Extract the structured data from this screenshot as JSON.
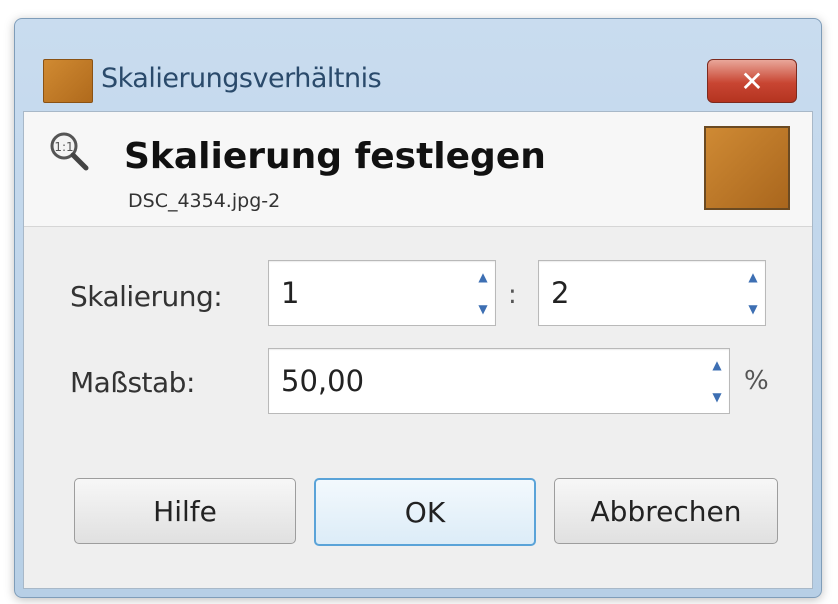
{
  "window": {
    "title": "Skalierungsverhältnis",
    "close_label": "✕"
  },
  "header": {
    "title": "Skalierung festlegen",
    "subtitle": "DSC_4354.jpg-2"
  },
  "form": {
    "scale_label": "Skalierung:",
    "scale_numerator": "1",
    "separator": ":",
    "scale_denominator": "2",
    "percent_label": "Maßstab:",
    "percent_value": "50,00",
    "percent_unit": "%"
  },
  "buttons": {
    "help": "Hilfe",
    "ok": "OK",
    "cancel": "Abbrechen"
  },
  "colors": {
    "accent": "#5aa3d8",
    "close": "#c84532",
    "titlebar": "#c9dcef"
  }
}
